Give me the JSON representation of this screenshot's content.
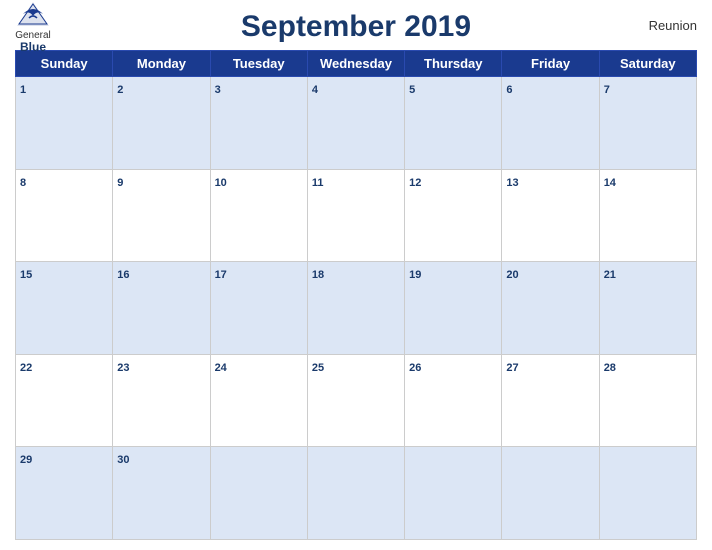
{
  "header": {
    "title": "September 2019",
    "region": "Reunion",
    "logo_general": "General",
    "logo_blue": "Blue"
  },
  "days_of_week": [
    "Sunday",
    "Monday",
    "Tuesday",
    "Wednesday",
    "Thursday",
    "Friday",
    "Saturday"
  ],
  "weeks": [
    [
      {
        "day": "1",
        "empty": false
      },
      {
        "day": "2",
        "empty": false
      },
      {
        "day": "3",
        "empty": false
      },
      {
        "day": "4",
        "empty": false
      },
      {
        "day": "5",
        "empty": false
      },
      {
        "day": "6",
        "empty": false
      },
      {
        "day": "7",
        "empty": false
      }
    ],
    [
      {
        "day": "8",
        "empty": false
      },
      {
        "day": "9",
        "empty": false
      },
      {
        "day": "10",
        "empty": false
      },
      {
        "day": "11",
        "empty": false
      },
      {
        "day": "12",
        "empty": false
      },
      {
        "day": "13",
        "empty": false
      },
      {
        "day": "14",
        "empty": false
      }
    ],
    [
      {
        "day": "15",
        "empty": false
      },
      {
        "day": "16",
        "empty": false
      },
      {
        "day": "17",
        "empty": false
      },
      {
        "day": "18",
        "empty": false
      },
      {
        "day": "19",
        "empty": false
      },
      {
        "day": "20",
        "empty": false
      },
      {
        "day": "21",
        "empty": false
      }
    ],
    [
      {
        "day": "22",
        "empty": false
      },
      {
        "day": "23",
        "empty": false
      },
      {
        "day": "24",
        "empty": false
      },
      {
        "day": "25",
        "empty": false
      },
      {
        "day": "26",
        "empty": false
      },
      {
        "day": "27",
        "empty": false
      },
      {
        "day": "28",
        "empty": false
      }
    ],
    [
      {
        "day": "29",
        "empty": false
      },
      {
        "day": "30",
        "empty": false
      },
      {
        "day": "",
        "empty": true
      },
      {
        "day": "",
        "empty": true
      },
      {
        "day": "",
        "empty": true
      },
      {
        "day": "",
        "empty": true
      },
      {
        "day": "",
        "empty": true
      }
    ]
  ]
}
